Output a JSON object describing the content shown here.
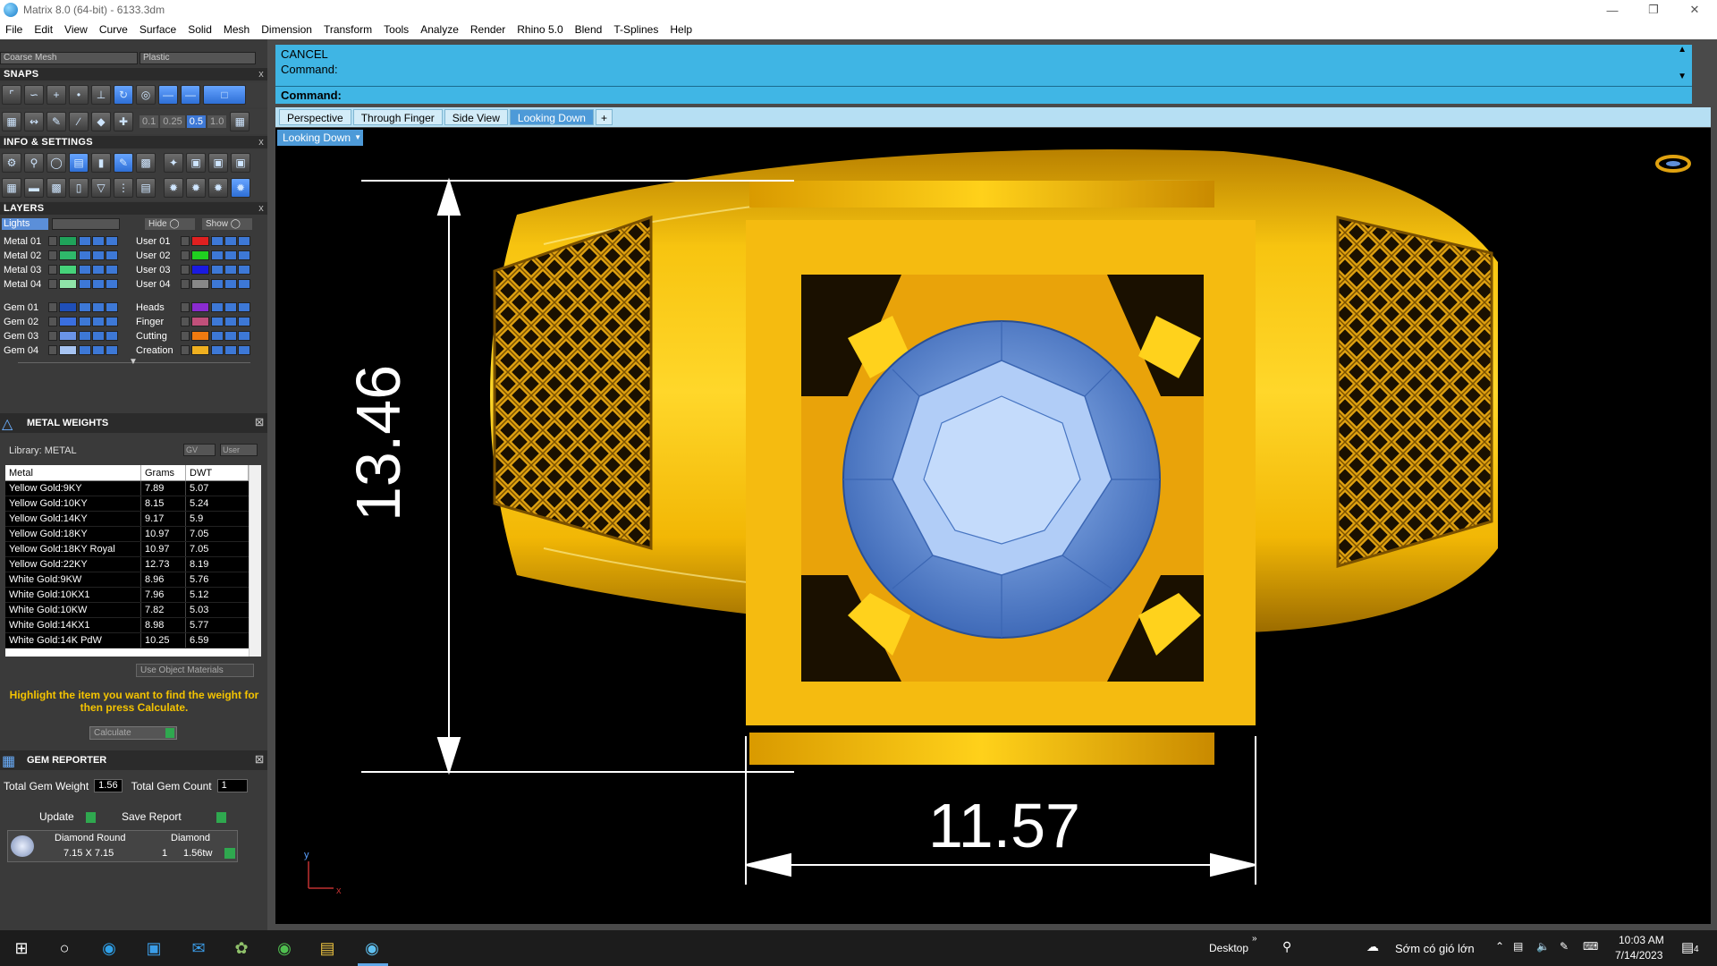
{
  "titlebar": {
    "title": "Matrix 8.0 (64-bit) - 6133.3dm"
  },
  "menu": [
    "File",
    "Edit",
    "View",
    "Curve",
    "Surface",
    "Solid",
    "Mesh",
    "Dimension",
    "Transform",
    "Tools",
    "Analyze",
    "Render",
    "Rhino 5.0",
    "Blend",
    "T-Splines",
    "Help"
  ],
  "top_dropdowns": {
    "mesh": "Coarse Mesh",
    "material": "Plastic"
  },
  "snaps": {
    "title": "SNAPS",
    "steps": [
      "0.1",
      "0.25",
      "0.5",
      "1.0"
    ]
  },
  "info": {
    "title": "INFO & SETTINGS"
  },
  "layers": {
    "title": "LAYERS",
    "lights_label": "Lights",
    "hide_label": "Hide",
    "show_label": "Show",
    "left": [
      {
        "name": "Metal 01",
        "color": "#1fa35a"
      },
      {
        "name": "Metal 02",
        "color": "#2fb86a"
      },
      {
        "name": "Metal 03",
        "color": "#46d27a"
      },
      {
        "name": "Metal 04",
        "color": "#8fe3a8"
      },
      {
        "name": "Gem 01",
        "color": "#1f4fb8"
      },
      {
        "name": "Gem 02",
        "color": "#3a6fe0"
      },
      {
        "name": "Gem 03",
        "color": "#6a94e8"
      },
      {
        "name": "Gem 04",
        "color": "#a7c4f2"
      }
    ],
    "right": [
      {
        "name": "User 01",
        "color": "#e02020"
      },
      {
        "name": "User 02",
        "color": "#20d020"
      },
      {
        "name": "User 03",
        "color": "#1a1ae0"
      },
      {
        "name": "User 04",
        "color": "#888888"
      },
      {
        "name": "Heads",
        "color": "#8a2bd0"
      },
      {
        "name": "Finger",
        "color": "#c0507a"
      },
      {
        "name": "Cutting",
        "color": "#f07a10"
      },
      {
        "name": "Creation",
        "color": "#f0b020"
      }
    ]
  },
  "metal_weights": {
    "title": "METAL WEIGHTS",
    "library": "Library: METAL",
    "gv_label": "GV",
    "user_label": "User",
    "columns": [
      "Metal",
      "Grams",
      "DWT"
    ],
    "rows": [
      [
        "Yellow Gold:9KY",
        "7.89",
        "5.07"
      ],
      [
        "Yellow Gold:10KY",
        "8.15",
        "5.24"
      ],
      [
        "Yellow Gold:14KY",
        "9.17",
        "5.9"
      ],
      [
        "Yellow Gold:18KY",
        "10.97",
        "7.05"
      ],
      [
        "Yellow Gold:18KY Royal",
        "10.97",
        "7.05"
      ],
      [
        "Yellow Gold:22KY",
        "12.73",
        "8.19"
      ],
      [
        "White Gold:9KW",
        "8.96",
        "5.76"
      ],
      [
        "White Gold:10KX1",
        "7.96",
        "5.12"
      ],
      [
        "White Gold:10KW",
        "7.82",
        "5.03"
      ],
      [
        "White Gold:14KX1",
        "8.98",
        "5.77"
      ],
      [
        "White Gold:14K PdW",
        "10.25",
        "6.59"
      ]
    ],
    "use_object_materials": "Use Object Materials",
    "hint": "Highlight the item you want to find the weight for then press Calculate.",
    "calculate": "Calculate"
  },
  "gem_reporter": {
    "title": "GEM REPORTER",
    "total_weight_label": "Total Gem Weight",
    "total_weight": "1.56",
    "total_count_label": "Total Gem Count",
    "total_count": "1",
    "update": "Update",
    "save_report": "Save Report",
    "gem": {
      "shape": "Diamond Round",
      "type": "Diamond",
      "size": "7.15 X 7.15",
      "count": "1",
      "weight": "1.56tw"
    }
  },
  "command": {
    "line1": "CANCEL",
    "line2": "Command:",
    "prompt": "Command:"
  },
  "view_tabs": [
    "Perspective",
    "Through Finger",
    "Side View",
    "Looking Down"
  ],
  "active_view": "Looking Down",
  "viewport": {
    "dim_vertical": "13.46",
    "dim_horizontal": "11.57",
    "axis_y": "y",
    "axis_x": "x"
  },
  "taskbar": {
    "desktop": "Desktop",
    "weather": "Sớm có gió lớn",
    "time": "10:03 AM",
    "date": "7/14/2023",
    "notif": "4"
  },
  "colors": {
    "gold": "#f2b705",
    "gold_dark": "#b07800",
    "command_bg": "#3fb5e4",
    "gem": "#6f9be6"
  }
}
